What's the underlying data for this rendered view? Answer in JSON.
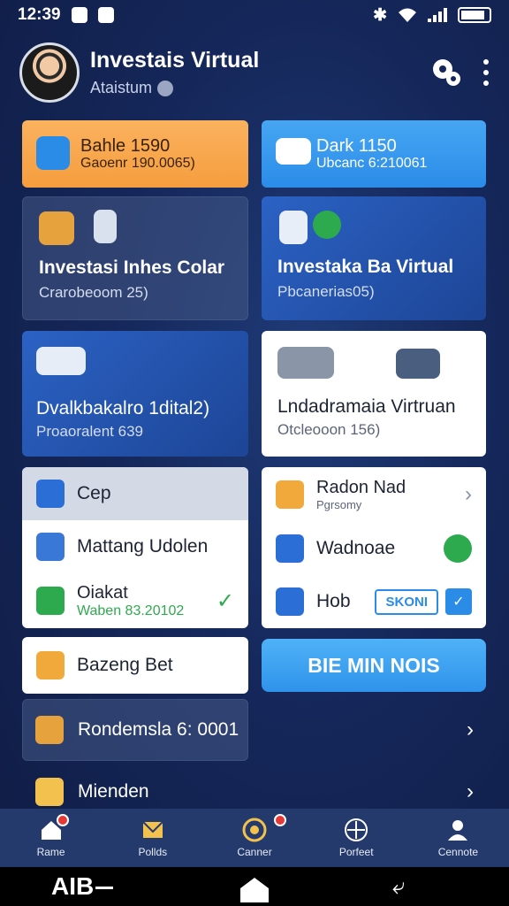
{
  "status": {
    "time": "12:39"
  },
  "header": {
    "title": "Investais Virtual",
    "subtitle": "Ataistum",
    "settings_icon": "gear-icon",
    "more_icon": "kebab-icon"
  },
  "cards": {
    "bank_left": {
      "title": "Bahle 1590",
      "sub": "Gaoenr 190.0065)"
    },
    "bank_right": {
      "title": "Dark 1150",
      "sub": "Ubcanc 6:210061"
    },
    "invest_left": {
      "title": "Investasi Inhes Colar",
      "sub": "Crarobeoom 25)"
    },
    "invest_right": {
      "title": "Investaka Ba Virtual",
      "sub": "Pbcanerias05)"
    },
    "dival": {
      "title": "Dvalkbakalro 1dital2)",
      "sub": "Proaoralent 639"
    },
    "lndap": {
      "title": "Lndadramaia Virtruan",
      "sub": "Otcleooon 156)"
    }
  },
  "list_left": {
    "header": "Cep",
    "rows": [
      {
        "label": "Mattang Udolen"
      },
      {
        "label": "Oiakat",
        "sub": "Waben 83.20102"
      }
    ]
  },
  "list_right": {
    "rows": [
      {
        "label": "Radon Nad",
        "sub": "Pgrsomy"
      },
      {
        "label": "Wadnoae"
      },
      {
        "label": "Hob",
        "tag": "SKONI"
      }
    ]
  },
  "bottom": {
    "bazeng": "Bazeng Bet",
    "cta": "BIE MIN NOIS",
    "rondemsla": "Rondemsla 6: 0001",
    "mienden": "Mienden"
  },
  "navbar": [
    {
      "label": "Rame",
      "icon": "home-icon"
    },
    {
      "label": "Pollds",
      "icon": "envelope-icon"
    },
    {
      "label": "Canner",
      "icon": "badge-icon"
    },
    {
      "label": "Porfeet",
      "icon": "compass-icon"
    },
    {
      "label": "Cennote",
      "icon": "user-icon"
    }
  ],
  "system_nav": {
    "left_text": "AIB"
  },
  "colors": {
    "orange": "#f59d3e",
    "blue": "#2b8ce8",
    "dark_bg": "#15275a",
    "green": "#2eaa4e"
  }
}
